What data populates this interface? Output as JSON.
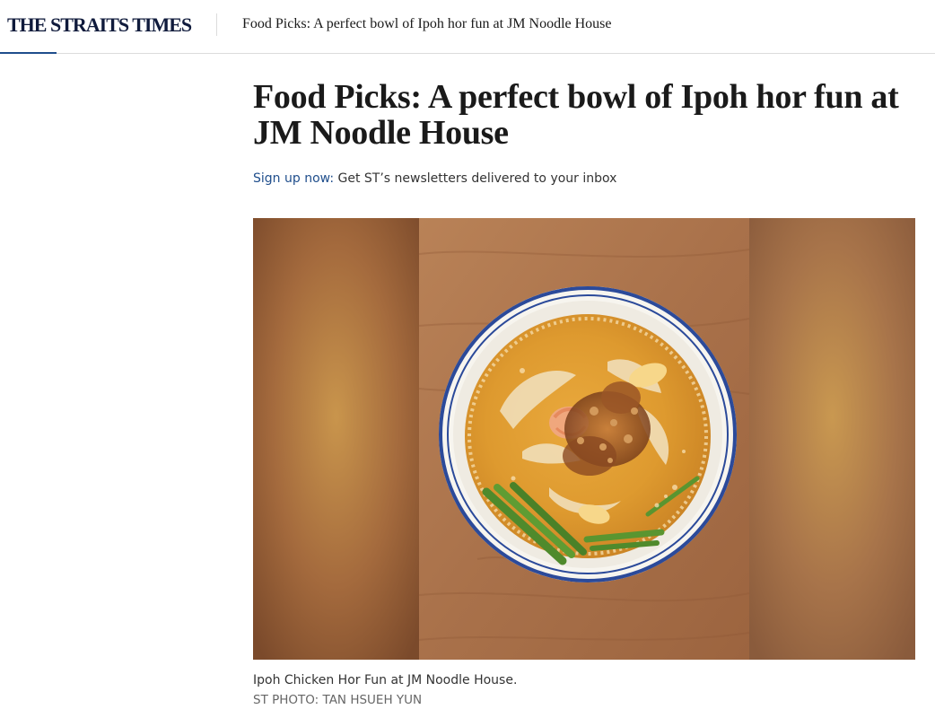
{
  "header": {
    "logo_text": "THE STRAITS TIMES",
    "article_title": "Food Picks: A perfect bowl of Ipoh hor fun at JM Noodle House",
    "reading_progress": 0.06
  },
  "article": {
    "headline": "Food Picks: A perfect bowl of Ipoh hor fun at JM Noodle House",
    "newsletter": {
      "link_label": "Sign up now:",
      "text": "Get ST’s newsletters delivered to your inbox"
    },
    "image": {
      "caption": "Ipoh Chicken Hor Fun at JM Noodle House.",
      "credit": "ST PHOTO: TAN HSUEH YUN"
    }
  },
  "colors": {
    "brand_navy": "#101b3c",
    "link_blue": "#1f4e8c"
  }
}
